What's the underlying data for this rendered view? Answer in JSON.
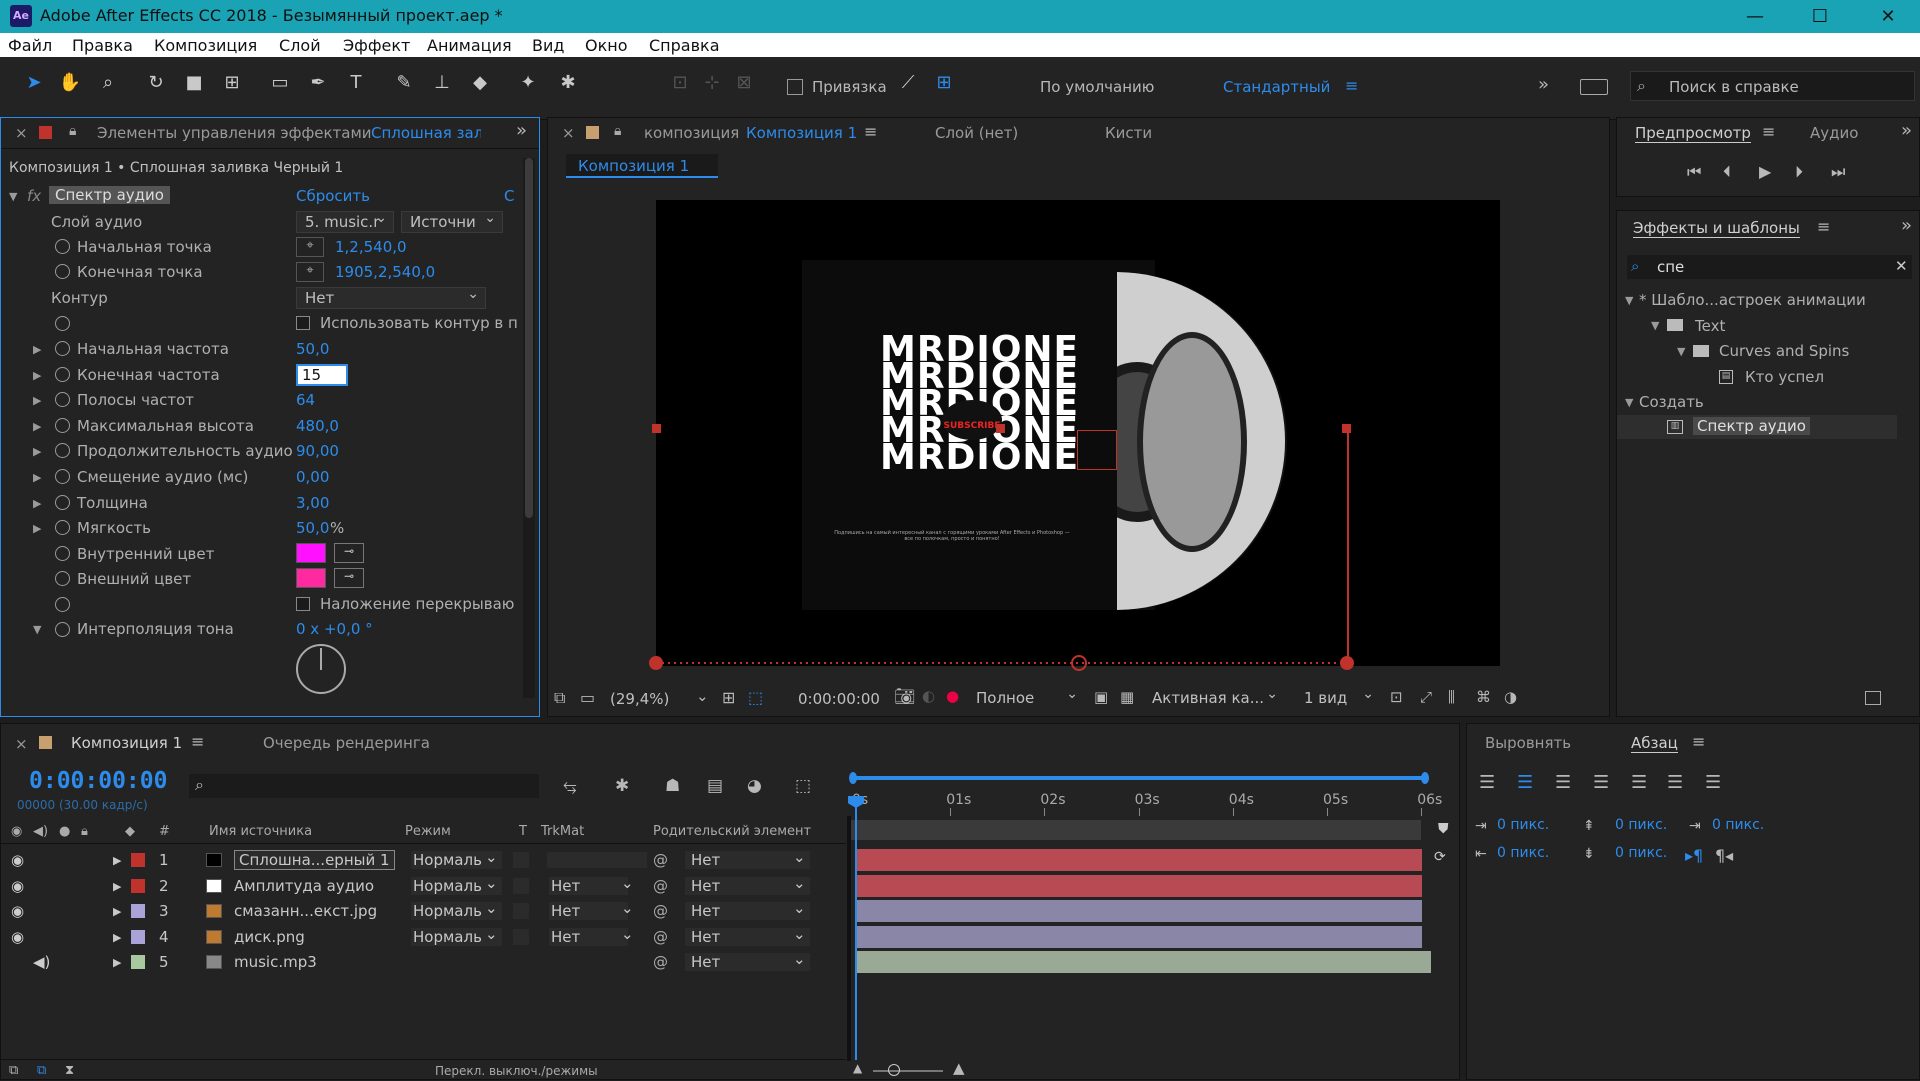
{
  "app": {
    "title": "Adobe After Effects CC 2018 - Безымянный проект.aep *",
    "icon": "Ae",
    "icon_name": "after-effects-logo"
  },
  "menu": [
    "Файл",
    "Правка",
    "Композиция",
    "Слой",
    "Эффект",
    "Анимация",
    "Вид",
    "Окно",
    "Справка"
  ],
  "toolbar": {
    "snap_label": "Привязка",
    "workspace_default": "По умолчанию",
    "workspace_standard": "Стандартный",
    "help_search": "Поиск в справке"
  },
  "effects_panel": {
    "tab": "Элементы управления эффектами",
    "tab_layer": "Сплошная зал",
    "path": "Композиция 1 • Сплошная заливка Черный 1",
    "fx": "fx",
    "effect_name": "Спектр аудио",
    "reset": "Сбросить",
    "more": "С",
    "audio_layer": {
      "label": "Слой аудио",
      "value": "5. music.r",
      "source": "Источни"
    },
    "start_point": {
      "label": "Начальная точка",
      "value": "1,2,540,0"
    },
    "end_point": {
      "label": "Конечная точка",
      "value": "1905,2,540,0"
    },
    "path_label": "Контур",
    "path_value": "Нет",
    "use_path": "Использовать контур в п",
    "params": [
      {
        "label": "Начальная частота",
        "value": "50,0"
      },
      {
        "label": "Конечная частота",
        "value": "15"
      },
      {
        "label": "Полосы частот",
        "value": "64"
      },
      {
        "label": "Максимальная высота",
        "value": "480,0"
      },
      {
        "label": "Продолжительность аудио",
        "value": "90,00"
      },
      {
        "label": "Смещение аудио (мс)",
        "value": "0,00"
      },
      {
        "label": "Толщина",
        "value": "3,00"
      },
      {
        "label": "Мягкость",
        "value": "50,0",
        "unit": "%"
      }
    ],
    "inner_color": {
      "label": "Внутренний цвет",
      "color": "#ff10ff"
    },
    "outer_color": {
      "label": "Внешний цвет",
      "color": "#ff2aa0"
    },
    "overlap": "Наложение перекрываю",
    "hue": {
      "label": "Интерполяция тона",
      "value": "0 x +0,0 °"
    }
  },
  "comp_panel": {
    "tab_prefix": "композиция",
    "tab_name": "Композиция 1",
    "layer_tab": "Слой (нет)",
    "brushes_tab": "Кисти",
    "breadcrumb": "Композиция 1",
    "zoom": "(29,4%)",
    "time": "0:00:00:00",
    "quality": "Полное",
    "camera": "Активная ка...",
    "views": "1 вид",
    "art": {
      "line": "MRDIONE",
      "badge": "SUBSCRIBE",
      "small": "Подпишись на самый интересный канал с горящими уроками After Effects и Photoshop — все по полочкам, просто и понятно!"
    }
  },
  "preview": {
    "tab": "Предпросмотр",
    "audio_tab": "Аудио"
  },
  "effects_browser": {
    "tab": "Эффекты и шаблоны",
    "search": "спе",
    "tree": [
      {
        "label": "* Шабло...астроек анимации",
        "icon": "folder-icon"
      },
      {
        "label": "Text",
        "icon": "folder-icon"
      },
      {
        "label": "Curves and Spins",
        "icon": "folder-icon"
      },
      {
        "label": "Кто успел",
        "icon": "preset-icon"
      },
      {
        "label": "Создать",
        "icon": "none"
      },
      {
        "label": "Спектр аудио",
        "icon": "effect-icon"
      }
    ]
  },
  "timeline": {
    "tab": "Композиция 1",
    "render_queue": "Очередь рендеринга",
    "timecode": "0:00:00:00",
    "fps": "00000 (30.00 кадр/с)",
    "columns": {
      "source": "Имя источника",
      "mode": "Режим",
      "t": "T",
      "trkmat": "TrkMat",
      "parent": "Родительский элемент",
      "num": "#"
    },
    "ruler": [
      "0s",
      "01s",
      "02s",
      "03s",
      "04s",
      "05s",
      "06s"
    ],
    "layers": [
      {
        "num": "1",
        "name": "Сплошна...ерный 1",
        "mode": "Нормаль",
        "trk": "",
        "parent": "Нет",
        "label_color": "#c0322c",
        "thumb": "#000000",
        "bar": "#b84a53",
        "has_eye": true
      },
      {
        "num": "2",
        "name": "Амплитуда аудио",
        "mode": "Нормаль",
        "trk": "Нет",
        "parent": "Нет",
        "label_color": "#c0322c",
        "thumb": "#ffffff",
        "bar": "#b84a53",
        "has_eye": true
      },
      {
        "num": "3",
        "name": "смазанн...екст.jpg",
        "mode": "Нормаль",
        "trk": "Нет",
        "parent": "Нет",
        "label_color": "#a9a3d8",
        "thumb": "#c07a30",
        "bar": "#8a86a8",
        "has_eye": true
      },
      {
        "num": "4",
        "name": "диск.png",
        "mode": "Нормаль",
        "trk": "Нет",
        "parent": "Нет",
        "label_color": "#a9a3d8",
        "thumb": "#c07a30",
        "bar": "#8a86a8",
        "has_eye": true
      },
      {
        "num": "5",
        "name": "music.mp3",
        "mode": "",
        "trk": "",
        "parent": "Нет",
        "label_color": "#a8c8a0",
        "thumb": "#888888",
        "bar": "#9aa896",
        "has_eye": false
      }
    ],
    "footer": "Перекл. выключ./режимы"
  },
  "paragraph": {
    "align_tab": "Выровнять",
    "para_tab": "Абзац",
    "px": "0 пикс."
  }
}
